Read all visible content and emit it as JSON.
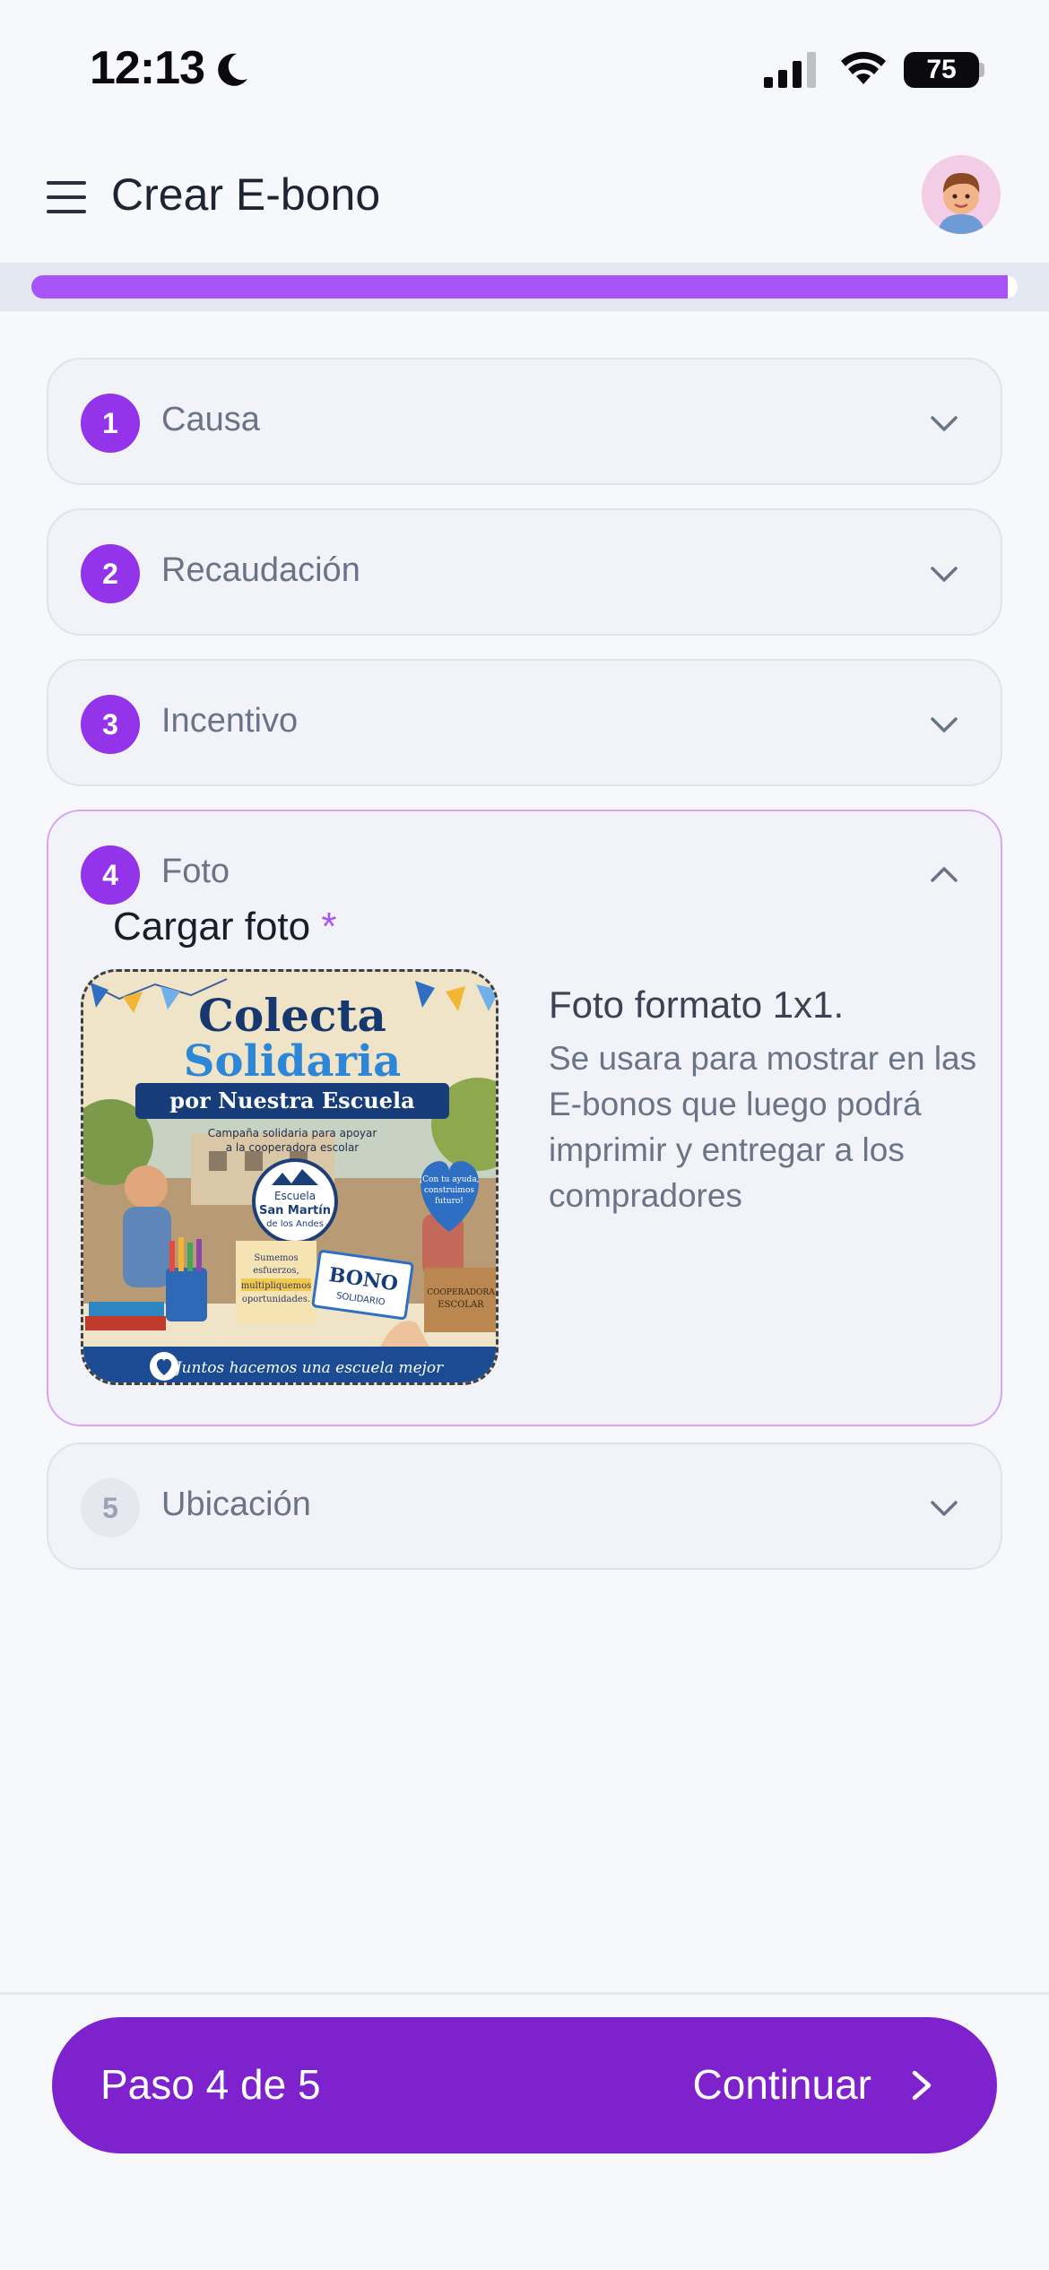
{
  "status_bar": {
    "time": "12:13",
    "battery": "75",
    "icons": [
      "moon-icon",
      "signal-icon",
      "wifi-icon",
      "battery-icon"
    ]
  },
  "header": {
    "title": "Crear E-bono",
    "menu_icon": "hamburger-menu-icon",
    "avatar": "user-avatar"
  },
  "progress": {
    "value_fraction": 0.99,
    "color": "#a855f7"
  },
  "steps": [
    {
      "number": "1",
      "label": "Causa",
      "state": "completed"
    },
    {
      "number": "2",
      "label": "Recaudación",
      "state": "completed"
    },
    {
      "number": "3",
      "label": "Incentivo",
      "state": "completed"
    },
    {
      "number": "4",
      "label": "Foto",
      "state": "open",
      "upload_title": "Cargar foto",
      "required_mark": "*",
      "photo_heading": "Foto formato 1x1.",
      "photo_description": "Se usara para mostrar en las E-bonos que luego podrá imprimir y entregar a los compradores",
      "photo": {
        "title_line1": "Colecta",
        "title_line2": "Solidaria",
        "banner": "por Nuestra Escuela",
        "subtitle_line1": "Campaña solidaria para apoyar",
        "subtitle_line2": "a la cooperadora escolar",
        "badge_line1": "Escuela",
        "badge_line2": "San Martín",
        "badge_line3": "de los Andes",
        "heart_line1": "¡Con tu ayuda,",
        "heart_line2": "construimos",
        "heart_line3": "futuro!",
        "note_line1": "Sumemos",
        "note_line2": "esfuerzos,",
        "note_line3": "multipliquemos",
        "note_line4": "oportunidades.",
        "ticket_line1": "BONO",
        "ticket_line2": "SOLIDARIO",
        "box_line1": "COOPERADORA",
        "box_line2": "ESCOLAR",
        "footer": "Juntos hacemos una escuela mejor"
      }
    },
    {
      "number": "5",
      "label": "Ubicación",
      "state": "pending"
    }
  ],
  "footer": {
    "step_text": "Paso 4 de 5",
    "continue_label": "Continuar",
    "color": "#7e22ce"
  }
}
